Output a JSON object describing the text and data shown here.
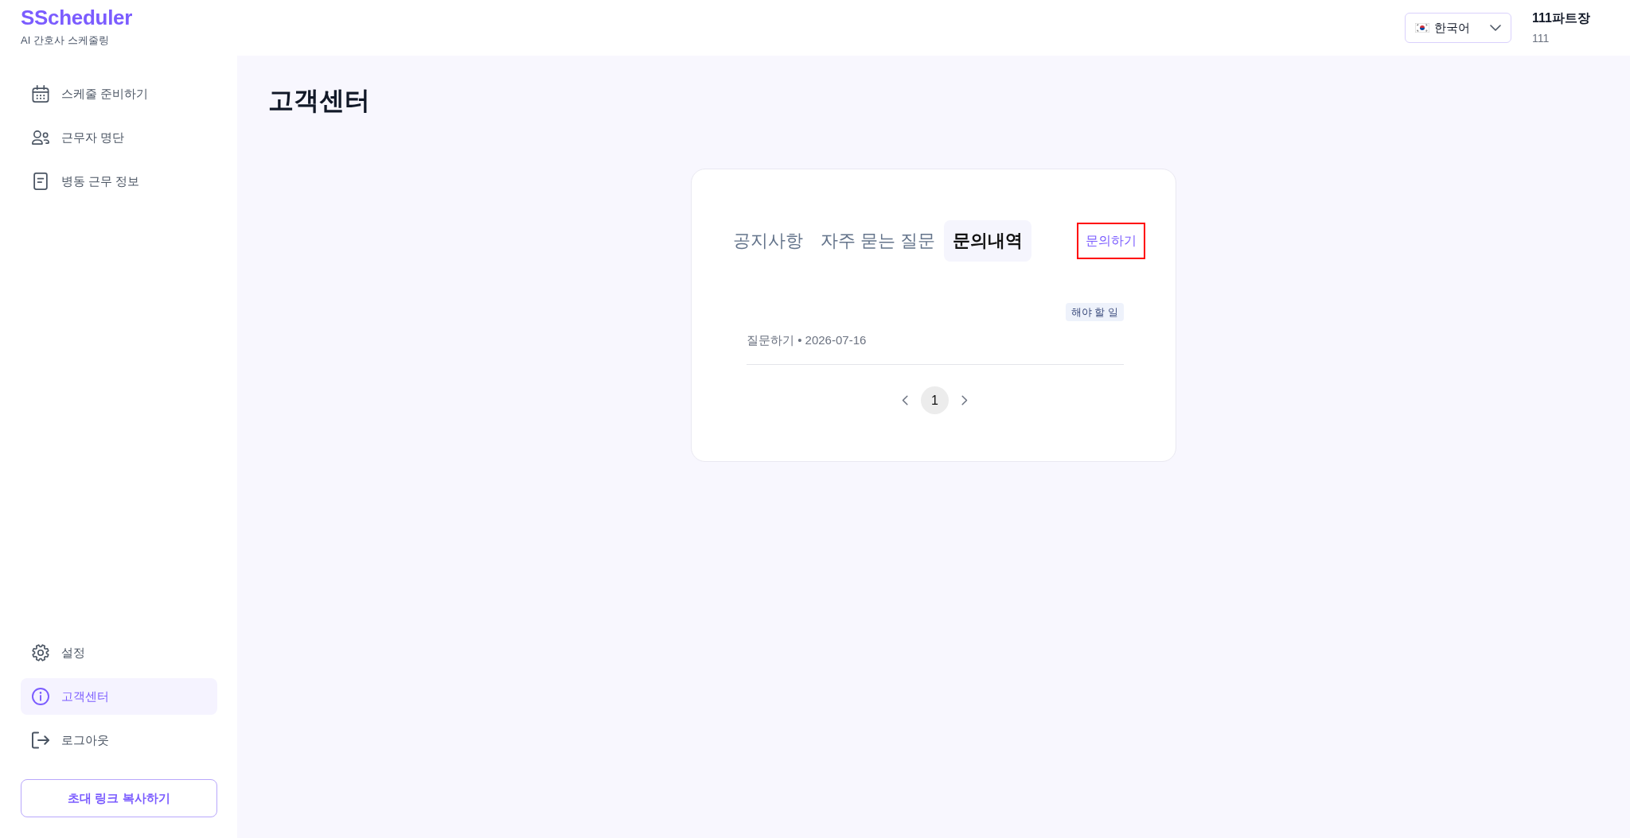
{
  "header": {
    "logo": "SScheduler",
    "tagline": "AI 간호사 스케줄링",
    "language_select": {
      "value": "한국어"
    },
    "user": {
      "name": "111파트장",
      "subtitle": "111"
    }
  },
  "sidebar": {
    "nav_items": [
      {
        "label": "스케줄 준비하기",
        "selected": false
      },
      {
        "label": "근무자 명단",
        "selected": false
      },
      {
        "label": "병동 근무 정보",
        "selected": false
      }
    ],
    "footer_items": [
      {
        "label": "설정",
        "selected": false
      },
      {
        "label": "고객센터",
        "selected": true
      },
      {
        "label": "로그아웃",
        "selected": false
      }
    ],
    "invite_button": {
      "label": "초대 링크 복사하기"
    }
  },
  "page": {
    "title": "고객센터"
  },
  "card": {
    "tabs": [
      {
        "label": "공지사항",
        "selected": false
      },
      {
        "label": "자주 묻는 질문",
        "selected": false
      },
      {
        "label": "문의내역",
        "selected": true
      }
    ],
    "action_button": {
      "label": "문의하기",
      "highlighted": true
    },
    "inquiries": [
      {
        "status": "해야 할 일",
        "meta": "질문하기 • 2026-07-16"
      }
    ],
    "pagination": {
      "pages": [
        {
          "label": "1",
          "selected": true
        }
      ]
    }
  }
}
